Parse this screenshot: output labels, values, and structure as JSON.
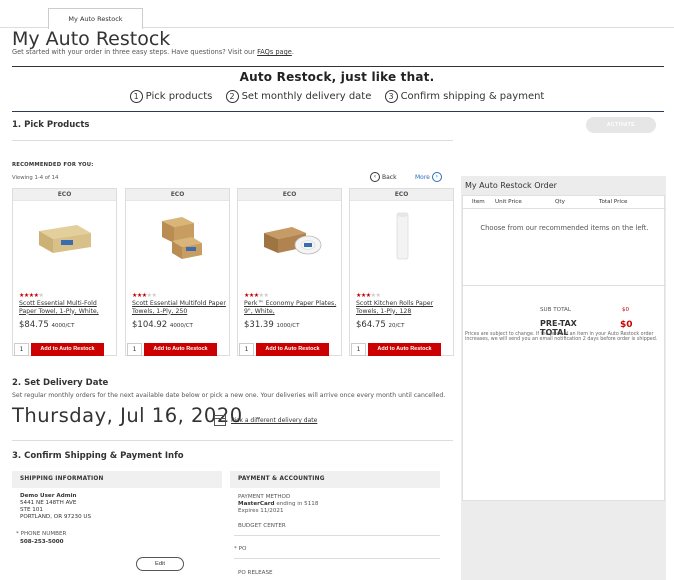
{
  "tab": {
    "label": "My Auto Restock"
  },
  "page": {
    "title": "My Auto Restock",
    "subtitle": "Get started with your order in three easy steps. Have questions? Visit our",
    "faq_link": "FAQs page",
    "subtitle_end": "."
  },
  "hero": {
    "title": "Auto Restock, just like that.",
    "steps": [
      {
        "num": "1",
        "label": "Pick products"
      },
      {
        "num": "2",
        "label": "Set monthly delivery date"
      },
      {
        "num": "3",
        "label": "Confirm shipping & payment"
      }
    ]
  },
  "section1": {
    "title": "1. Pick Products",
    "activate_label": "ACTIVATE",
    "recommended_label": "RECOMMENDED FOR YOU:",
    "viewing": "Viewing 1-4 of 14",
    "back_label": "Back",
    "more_label": "More"
  },
  "products": [
    {
      "badge": "ECO",
      "stars": 4,
      "name": "Scott Essential Multi-Fold Paper Towel, 1-Ply, White,",
      "price": "$84.75",
      "unit": "4000/CT",
      "qty": "1",
      "add_label": "Add to Auto Restock"
    },
    {
      "badge": "ECO",
      "stars": 3,
      "name": "Scott Essential Multifold Paper Towels, 1-Ply, 250",
      "price": "$104.92",
      "unit": "4000/CT",
      "qty": "1",
      "add_label": "Add to Auto Restock"
    },
    {
      "badge": "ECO",
      "stars": 3,
      "name": "Perk™ Economy Paper Plates, 9\", White,",
      "price": "$31.39",
      "unit": "1000/CT",
      "qty": "1",
      "add_label": "Add to Auto Restock"
    },
    {
      "badge": "ECO",
      "stars": 3,
      "name": "Scott Kitchen Rolls Paper Towels, 1-Ply, 128",
      "price": "$64.75",
      "unit": "20/CT",
      "qty": "1",
      "add_label": "Add to Auto Restock"
    }
  ],
  "section2": {
    "title": "2. Set Delivery Date",
    "subtitle": "Set regular monthly orders for the next available date below or pick a new one. Your deliveries will arrive once every month until cancelled.",
    "date": "Thursday, Jul 16, 2020",
    "pick_link": "Pick a different delivery date"
  },
  "section3": {
    "title": "3. Confirm Shipping & Payment Info",
    "shipping": {
      "header": "SHIPPING INFORMATION",
      "name": "Demo User Admin",
      "addr1": "5441 NE 148TH AVE",
      "addr2": "STE 101",
      "addr3": "PORTLAND, OR 97230 US",
      "phone_label": "* PHONE NUMBER",
      "phone": "508-253-5000",
      "edit_label": "Edit"
    },
    "payment": {
      "header": "PAYMENT & ACCOUNTING",
      "method_label": "PAYMENT METHOD",
      "card_brand": "MasterCard",
      "card_rest": " ending in 5118",
      "expires": "Expires 11/2021",
      "budget_label": "BUDGET CENTER",
      "po_label": "* PO",
      "po_release_label": "PO RELEASE"
    }
  },
  "sidebar": {
    "title": "My Auto Restock Order",
    "columns": [
      "Item",
      "Unit Price",
      "Qty",
      "Total Price"
    ],
    "empty_text": "Choose from our recommended items on the left.",
    "subtotal_label": "SUB TOTAL",
    "subtotal_value": "$0",
    "pretax_label_1": "PRE-TAX",
    "pretax_label_2": "TOTAL",
    "pretax_value": "$0",
    "disclaimer": "Prices are subject to change. If the price of an item in your Auto Restock order increases, we will send you an email notification 2 days before order is shipped."
  },
  "colors": {
    "accent_red": "#cc0000",
    "link_blue": "#2a6ebb"
  }
}
